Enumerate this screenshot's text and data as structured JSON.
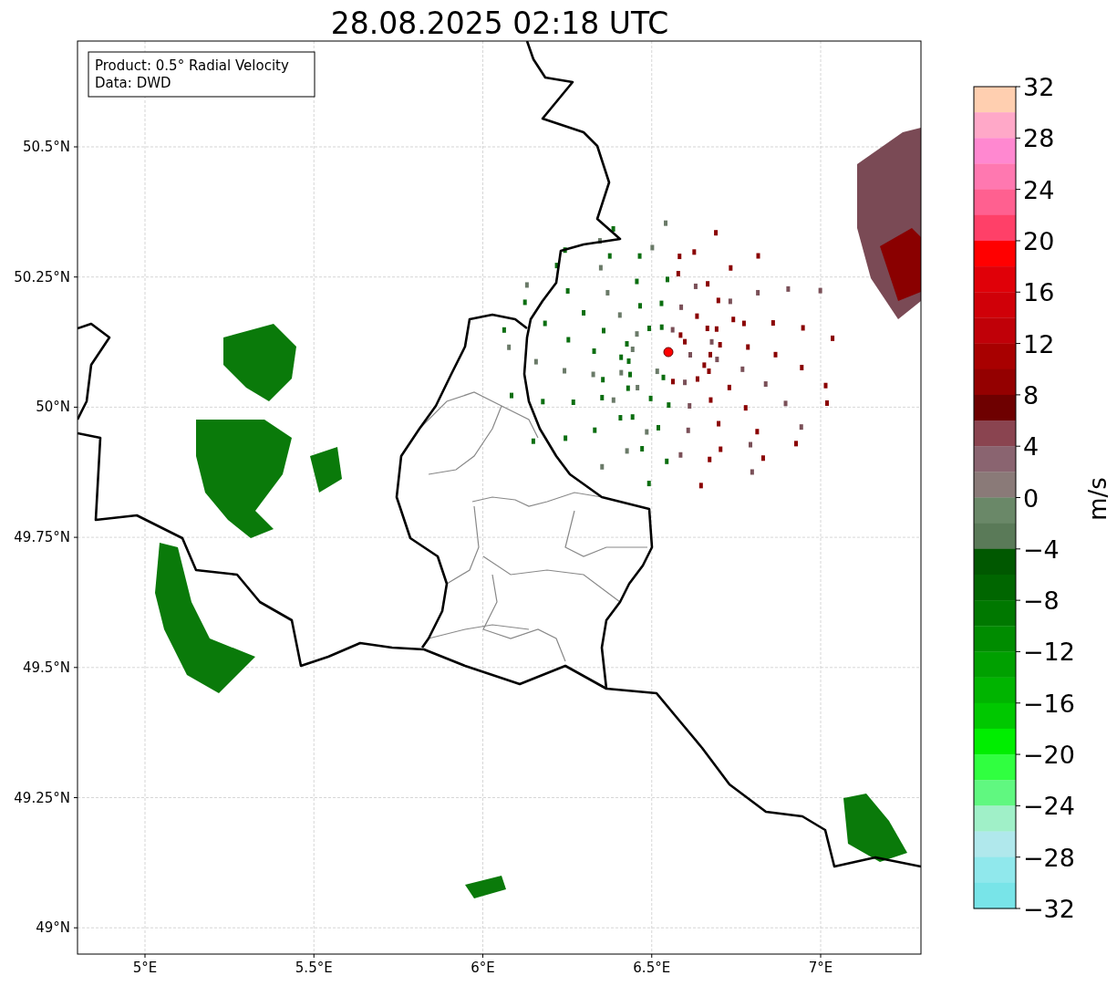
{
  "title": "28.08.2025 02:18 UTC",
  "legend": [
    "Product: 0.5° Radial Velocity",
    "Data: DWD"
  ],
  "x_ticks": [
    "5°E",
    "5.5°E",
    "6°E",
    "6.5°E",
    "7°E"
  ],
  "y_ticks": [
    "50.5°N",
    "50.25°N",
    "50°N",
    "49.75°N",
    "49.5°N",
    "49.25°N",
    "49°N"
  ],
  "colorbar": {
    "label": "m/s",
    "ticks": [
      "32",
      "28",
      "24",
      "20",
      "16",
      "12",
      "8",
      "4",
      "0",
      "−4",
      "−8",
      "−12",
      "−16",
      "−20",
      "−24",
      "−28",
      "−32"
    ],
    "bins": [
      {
        "color": "#ffcfb0"
      },
      {
        "color": "#ffa8c8"
      },
      {
        "color": "#ff88d0"
      },
      {
        "color": "#ff78b0"
      },
      {
        "color": "#ff6090"
      },
      {
        "color": "#ff4068"
      },
      {
        "color": "#ff0000"
      },
      {
        "color": "#e00008"
      },
      {
        "color": "#d00008"
      },
      {
        "color": "#c00008"
      },
      {
        "color": "#a80000"
      },
      {
        "color": "#940000"
      },
      {
        "color": "#6e0000"
      },
      {
        "color": "#8a4450"
      },
      {
        "color": "#8a6470"
      },
      {
        "color": "#8a7a78"
      },
      {
        "color": "#6a8868"
      },
      {
        "color": "#5a7a58"
      },
      {
        "color": "#005800"
      },
      {
        "color": "#006600"
      },
      {
        "color": "#007800"
      },
      {
        "color": "#008c00"
      },
      {
        "color": "#00a000"
      },
      {
        "color": "#00b400"
      },
      {
        "color": "#00c800"
      },
      {
        "color": "#00ee00"
      },
      {
        "color": "#30ff40"
      },
      {
        "color": "#60f880"
      },
      {
        "color": "#a0f0c8"
      },
      {
        "color": "#b0e8ec"
      },
      {
        "color": "#90e8ec"
      },
      {
        "color": "#78e4e8"
      }
    ]
  }
}
